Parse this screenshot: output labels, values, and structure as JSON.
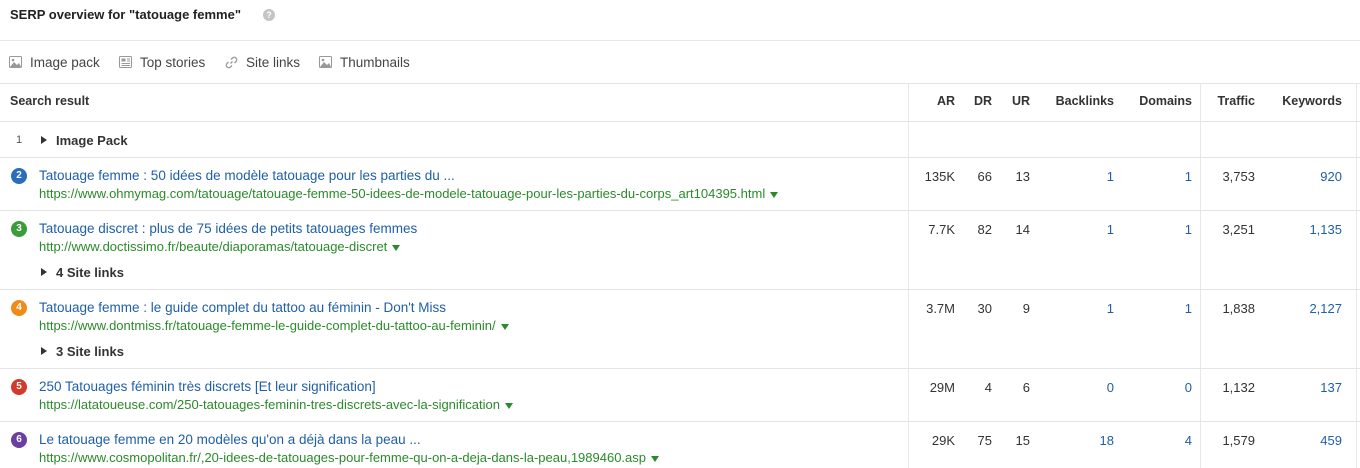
{
  "header": {
    "title": "SERP overview for \"tatouage femme\"",
    "help": "?"
  },
  "filters": [
    {
      "label": "Image pack",
      "icon": "image-icon"
    },
    {
      "label": "Top stories",
      "icon": "newspaper-icon"
    },
    {
      "label": "Site links",
      "icon": "link-icon"
    },
    {
      "label": "Thumbnails",
      "icon": "thumbnail-icon"
    }
  ],
  "columns": {
    "search_result": "Search result",
    "ar": "AR",
    "dr": "DR",
    "ur": "UR",
    "backlinks": "Backlinks",
    "domains": "Domains",
    "traffic": "Traffic",
    "keywords": "Keywords"
  },
  "image_pack": {
    "rank": "1",
    "label": "Image Pack"
  },
  "rows": [
    {
      "rank": "2",
      "color": "#2a6ebb",
      "title": "Tatouage femme : 50 idées de modèle tatouage pour les parties du ...",
      "url": "https://www.ohmymag.com/tatouage/tatouage-femme-50-idees-de-modele-tatouage-pour-les-parties-du-corps_art104395.html",
      "ar": "135K",
      "dr": "66",
      "ur": "13",
      "backlinks": "1",
      "domains": "1",
      "traffic": "3,753",
      "keywords": "920"
    },
    {
      "rank": "3",
      "color": "#3a9c3a",
      "title": "Tatouage discret : plus de 75 idées de petits tatouages femmes",
      "url": "http://www.doctissimo.fr/beaute/diaporamas/tatouage-discret",
      "ar": "7.7K",
      "dr": "82",
      "ur": "14",
      "backlinks": "1",
      "domains": "1",
      "traffic": "3,251",
      "keywords": "1,135",
      "sitelinks": "4 Site links"
    },
    {
      "rank": "4",
      "color": "#f08a18",
      "title": "Tatouage femme : le guide complet du tattoo au féminin - Don't Miss",
      "url": "https://www.dontmiss.fr/tatouage-femme-le-guide-complet-du-tattoo-au-feminin/",
      "ar": "3.7M",
      "dr": "30",
      "ur": "9",
      "backlinks": "1",
      "domains": "1",
      "traffic": "1,838",
      "keywords": "2,127",
      "sitelinks": "3 Site links"
    },
    {
      "rank": "5",
      "color": "#d33a2c",
      "title": "250 Tatouages féminin très discrets [Et leur signification]",
      "url": "https://latatoueuse.com/250-tatouages-feminin-tres-discrets-avec-la-signification",
      "ar": "29M",
      "dr": "4",
      "ur": "6",
      "backlinks": "0",
      "domains": "0",
      "traffic": "1,132",
      "keywords": "137"
    },
    {
      "rank": "6",
      "color": "#6b3fa0",
      "title": "Le tatouage femme en 20 modèles qu'on a déjà dans la peau ...",
      "url": "https://www.cosmopolitan.fr/,20-idees-de-tatouages-pour-femme-qu-on-a-deja-dans-la-peau,1989460.asp",
      "ar": "29K",
      "dr": "75",
      "ur": "15",
      "backlinks": "18",
      "domains": "4",
      "traffic": "1,579",
      "keywords": "459"
    }
  ]
}
